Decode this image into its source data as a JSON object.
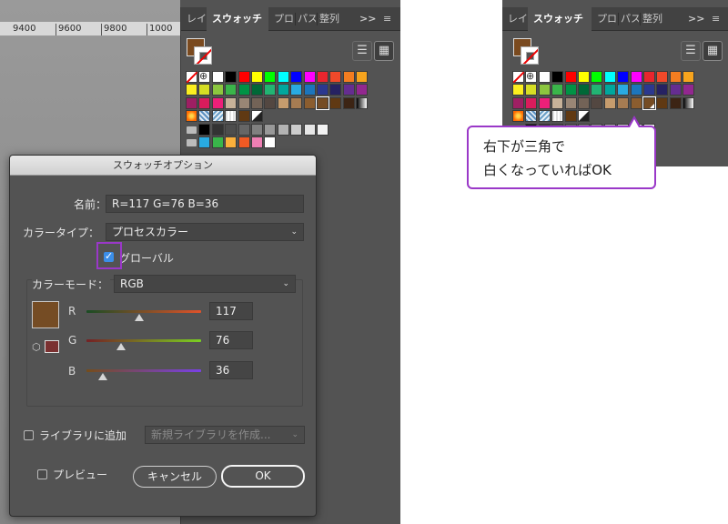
{
  "ruler": {
    "ticks": [
      "9400",
      "9600",
      "9800",
      "1000"
    ]
  },
  "panel": {
    "tabs": [
      "レイ",
      "スウォッチ",
      "プロ",
      "パス",
      "整列"
    ],
    "overflow": ">>",
    "menu_icon": "hamburger-icon",
    "list_view_icon": "list-view-icon",
    "grid_view_icon": "grid-view-icon",
    "fill_color": "#7a4a1f"
  },
  "swatches": {
    "row1": [
      "none",
      "reg",
      "#ffffff",
      "#000000",
      "#ff0000",
      "#ffff00",
      "#00ff00",
      "#00ffff",
      "#0000ff",
      "#ff00ff",
      "#e8262e",
      "#f0492a",
      "#f47d20",
      "#f7a41d"
    ],
    "row2": [
      "#fbee1f",
      "#d6de24",
      "#8cc63f",
      "#3ab54a",
      "#009345",
      "#006837",
      "#22b473",
      "#00a79d",
      "#29aae1",
      "#1c75bc",
      "#2b388f",
      "#262262",
      "#652d90",
      "#92278f"
    ],
    "row3": [
      "#9e1f63",
      "#d91c5c",
      "#ec2079",
      "#c7b299",
      "#998675",
      "#736357",
      "#534741",
      "#c69c6d",
      "#a67c52",
      "#8b5d2f",
      "sel",
      "#603913",
      "#3c2414",
      "grad1"
    ],
    "row4": [
      "flame",
      "pat",
      "pat2",
      "pat3",
      "#603913",
      "tri"
    ],
    "row5": [
      "folder",
      "#000000",
      "#333333",
      "#4d4d4d",
      "#666666",
      "#808080",
      "#999999",
      "#b3b3b3",
      "#cccccc",
      "#e6e6e6",
      "#f2f2f2"
    ],
    "row6": [
      "folder",
      "#29aae1",
      "#39b54a",
      "#fbb03b",
      "#f15a24",
      "#ee7fb3",
      "#ffffff"
    ]
  },
  "dialog": {
    "title": "スウォッチオプション",
    "name_label": "名前：",
    "name_value": "R=117 G=76 B=36",
    "color_type_label": "カラータイプ：",
    "color_type_value": "プロセスカラー",
    "global_label": "グローバル",
    "global_checked": true,
    "color_mode_label": "カラーモード：",
    "color_mode_value": "RGB",
    "r_label": "R",
    "g_label": "G",
    "b_label": "B",
    "r_value": "117",
    "g_value": "76",
    "b_value": "36",
    "r_fraction": 0.459,
    "g_fraction": 0.298,
    "b_fraction": 0.141,
    "preview_color": "#754c24",
    "out_of_gamut_color": "#7a3030",
    "add_to_library_label": "ライブラリに追加",
    "library_placeholder": "新規ライブラリを作成...",
    "preview_label": "プレビュー",
    "cancel_label": "キャンセル",
    "ok_label": "OK"
  },
  "callout": {
    "line1": "右下が三角で",
    "line2": "白くなっていればOK"
  },
  "colors": {
    "highlight": "#9a38c8"
  }
}
